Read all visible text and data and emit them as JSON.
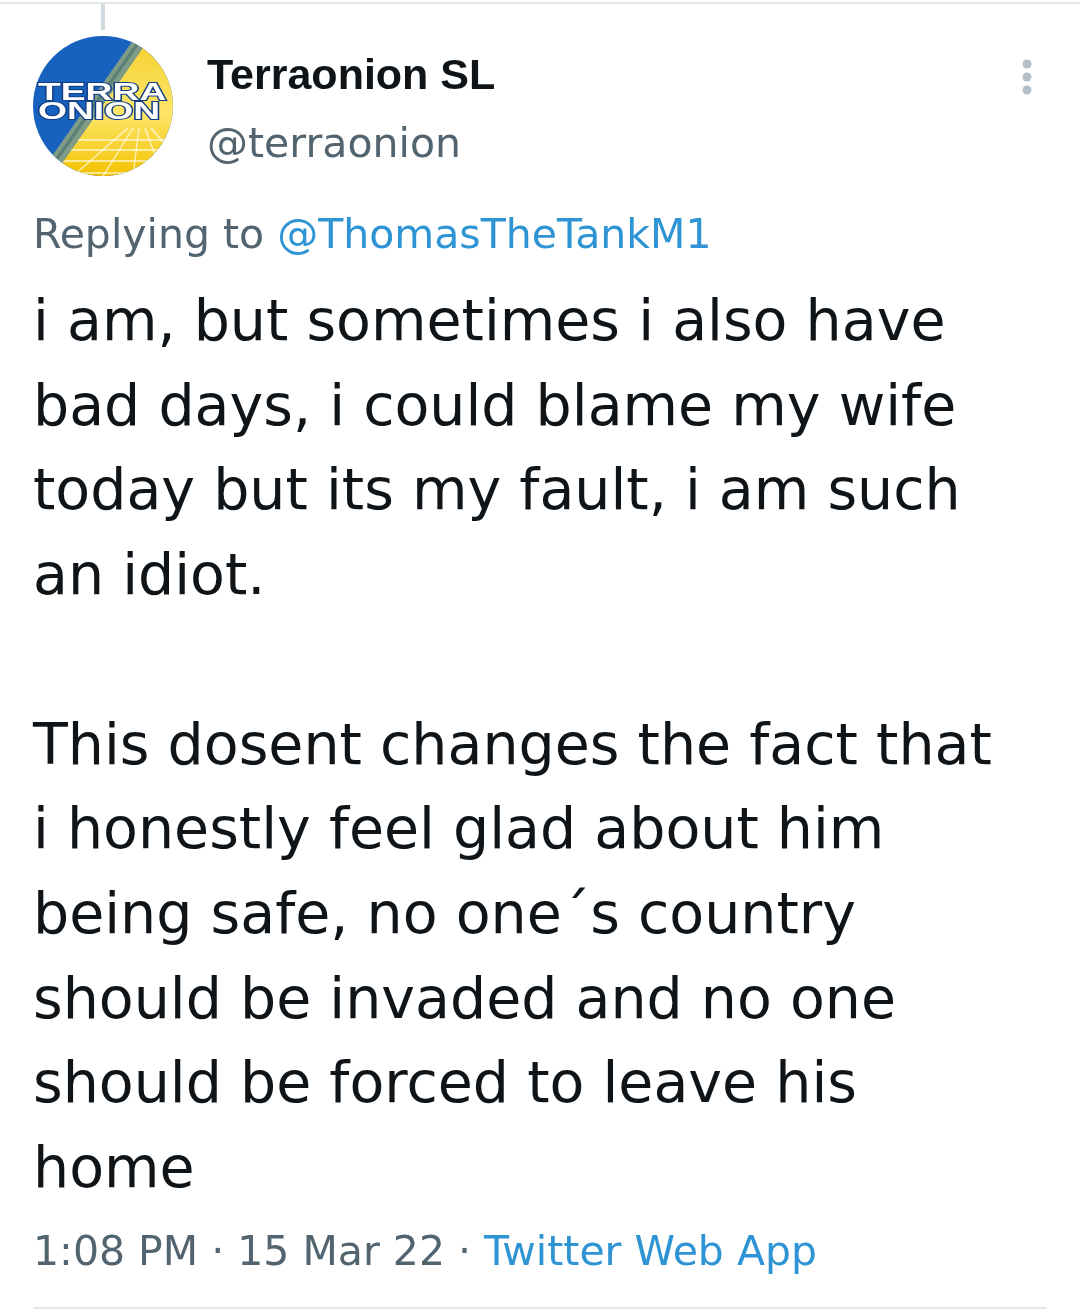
{
  "tweet": {
    "author": {
      "name": "Terraonion SL",
      "handle": "@terraonion",
      "avatar": {
        "logo_lines": [
          "TERRA",
          "ONION"
        ]
      }
    },
    "reply": {
      "label": "Replying to",
      "mention": "@ThomasTheTankM1"
    },
    "paragraphs": [
      "i am, but sometimes i also have bad days, i could blame my wife today but its my fault, i am such an idiot.",
      "This dosent changes the fact that i honestly feel glad about him being safe, no one´s country should be invaded and no one should be forced to leave his home"
    ],
    "meta": [
      {
        "kind": "time",
        "text": "1:08 PM"
      },
      {
        "kind": "separator",
        "text": "·"
      },
      {
        "kind": "date",
        "text": "15 Mar 22"
      },
      {
        "kind": "separator",
        "text": "·"
      },
      {
        "kind": "source",
        "text": "Twitter Web App"
      }
    ]
  }
}
